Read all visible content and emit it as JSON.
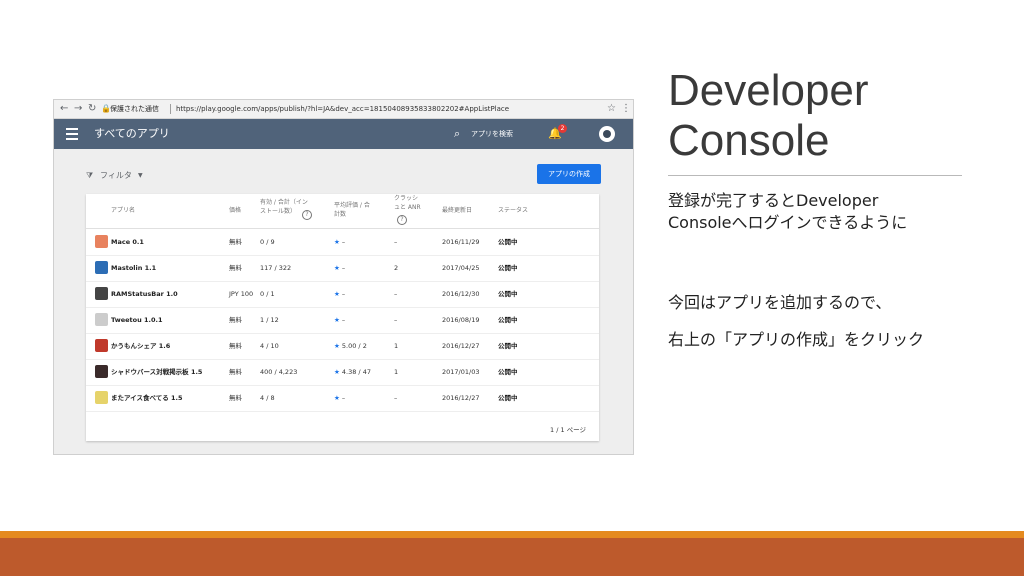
{
  "slide": {
    "title_line1": "Developer",
    "title_line2": "Console",
    "text1_line1": "登録が完了するとDeveloper",
    "text1_line2": "Consoleへログインできるように",
    "text2": "今回はアプリを追加するので、",
    "text3": "右上の「アプリの作成」をクリック"
  },
  "browser": {
    "secure_label": "保護された通信",
    "url": "https://play.google.com/apps/publish/?hl=JA&dev_acc=18150408935833802202#AppListPlace"
  },
  "appbar": {
    "title": "すべてのアプリ",
    "search_label": "アプリを検索",
    "notification_count": "2"
  },
  "toolbar": {
    "filter_label": "フィルタ",
    "create_label": "アプリの作成"
  },
  "table": {
    "headers": {
      "name": "アプリ名",
      "price": "価格",
      "installs_line1": "有効 / 合計（イン",
      "installs_line2": "ストール数）",
      "rating_line1": "平均評価 / 合",
      "rating_line2": "計数",
      "crash_line1": "クラッシ",
      "crash_line2": "ュと ANR",
      "updated": "最終更新日",
      "status": "ステータス"
    },
    "rows": [
      {
        "name": "Mace 0.1",
        "price": "無料",
        "installs": "0 / 9",
        "rating": "★ –",
        "crash": "–",
        "updated": "2016/11/29",
        "status": "公開中",
        "icon_color": "#e8825e"
      },
      {
        "name": "Mastolin 1.1",
        "price": "無料",
        "installs": "117 / 322",
        "rating": "★ –",
        "crash": "2",
        "updated": "2017/04/25",
        "status": "公開中",
        "icon_color": "#2c6db5"
      },
      {
        "name": "RAMStatusBar 1.0",
        "price": "JPY 100",
        "installs": "0 / 1",
        "rating": "★ –",
        "crash": "–",
        "updated": "2016/12/30",
        "status": "公開中",
        "icon_color": "#444444"
      },
      {
        "name": "Tweetou 1.0.1",
        "price": "無料",
        "installs": "1 / 12",
        "rating": "★ –",
        "crash": "–",
        "updated": "2016/08/19",
        "status": "公開中",
        "icon_color": "#cccccc"
      },
      {
        "name": "かうもんシェア 1.6",
        "price": "無料",
        "installs": "4 / 10",
        "rating": "★ 5.00 / 2",
        "crash": "1",
        "updated": "2016/12/27",
        "status": "公開中",
        "icon_color": "#c0392b"
      },
      {
        "name": "シャドウバース対戦掲示板 1.5",
        "price": "無料",
        "installs": "400 / 4,223",
        "rating": "★ 4.38 / 47",
        "crash": "1",
        "updated": "2017/01/03",
        "status": "公開中",
        "icon_color": "#3a2a2a"
      },
      {
        "name": "またアイス食べてる 1.5",
        "price": "無料",
        "installs": "4 / 8",
        "rating": "★ –",
        "crash": "–",
        "updated": "2016/12/27",
        "status": "公開中",
        "icon_color": "#e6d36a"
      }
    ],
    "pager": "1 / 1 ページ"
  }
}
